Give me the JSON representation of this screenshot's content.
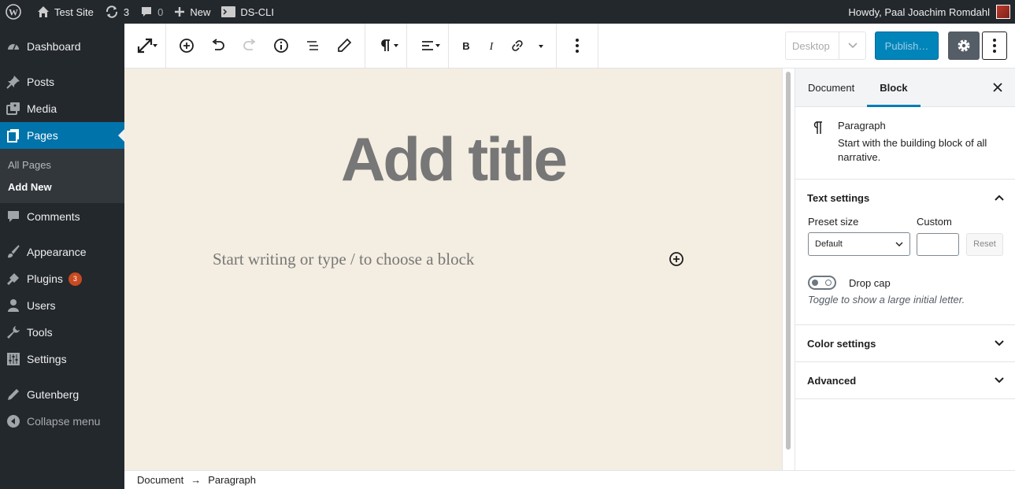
{
  "admin_bar": {
    "site_name": "Test Site",
    "updates_count": "3",
    "comments_count": "0",
    "new_label": "New",
    "plugin_label": "DS-CLI",
    "greeting": "Howdy, Paal Joachim Romdahl"
  },
  "sidebar": {
    "items": [
      {
        "label": "Dashboard",
        "icon": "dashboard-icon"
      },
      {
        "label": "Posts",
        "icon": "pin-icon"
      },
      {
        "label": "Media",
        "icon": "media-icon"
      },
      {
        "label": "Pages",
        "icon": "pages-icon",
        "current": true
      },
      {
        "label": "Comments",
        "icon": "comment-icon"
      },
      {
        "label": "Appearance",
        "icon": "brush-icon"
      },
      {
        "label": "Plugins",
        "icon": "plugin-icon",
        "badge": "3"
      },
      {
        "label": "Users",
        "icon": "user-icon"
      },
      {
        "label": "Tools",
        "icon": "wrench-icon"
      },
      {
        "label": "Settings",
        "icon": "settings-icon"
      },
      {
        "label": "Gutenberg",
        "icon": "pencil-icon"
      }
    ],
    "submenu": [
      "All Pages",
      "Add New"
    ],
    "collapse_label": "Collapse menu"
  },
  "toolbar": {
    "device_label": "Desktop",
    "publish_label": "Publish…"
  },
  "editor": {
    "title_placeholder": "Add title",
    "paragraph_placeholder": "Start writing or type / to choose a block"
  },
  "breadcrumb": {
    "items": [
      "Document",
      "Paragraph"
    ],
    "separator": "→"
  },
  "panel": {
    "tabs": [
      "Document",
      "Block"
    ],
    "active_tab": "Block",
    "block_title": "Paragraph",
    "block_description": "Start with the building block of all narrative.",
    "text_settings": {
      "heading": "Text settings",
      "preset_label": "Preset size",
      "custom_label": "Custom",
      "preset_value": "Default",
      "reset_label": "Reset",
      "dropcap_label": "Drop cap",
      "dropcap_help": "Toggle to show a large initial letter."
    },
    "color_settings": "Color settings",
    "advanced": "Advanced"
  },
  "colors": {
    "admin_bg": "#23282d",
    "accent": "#0073aa",
    "canvas_bg": "#f4ede1",
    "badge": "#ca4a1f"
  }
}
